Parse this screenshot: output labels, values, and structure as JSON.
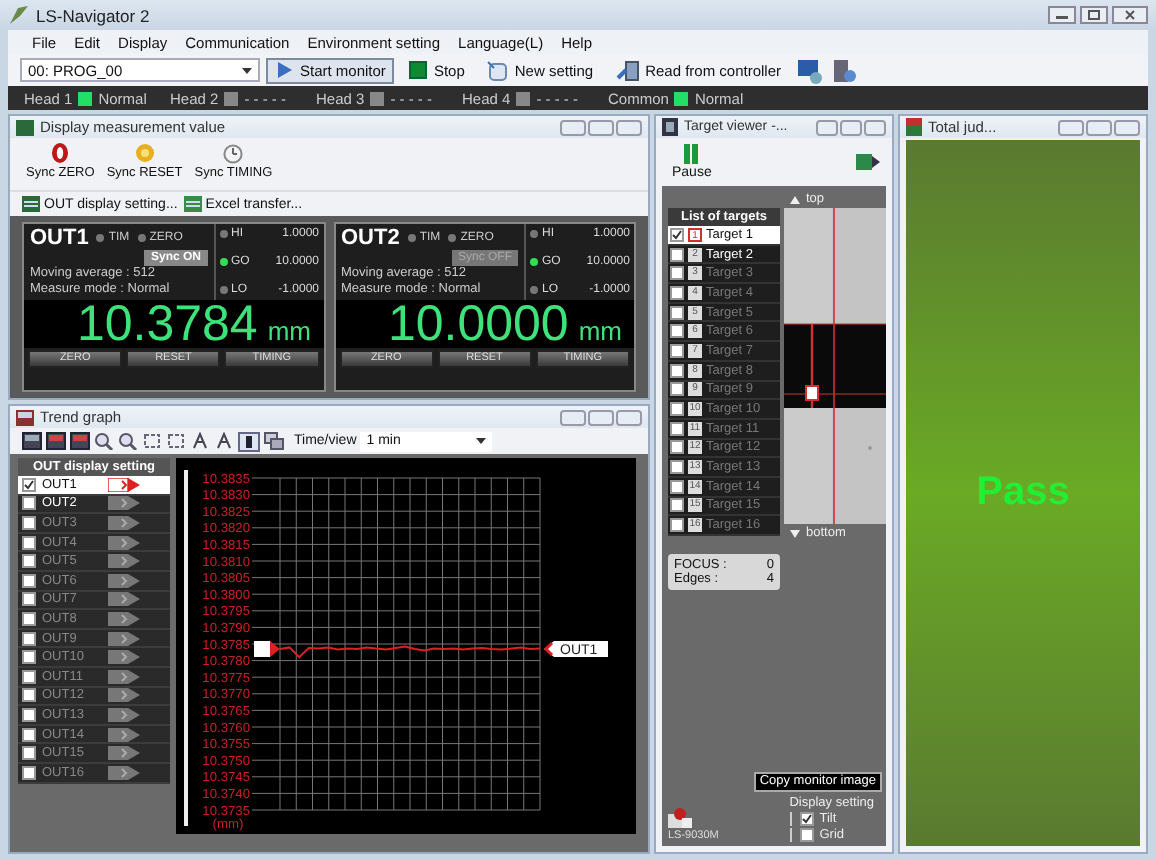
{
  "window": {
    "title": "LS-Navigator 2"
  },
  "menu": [
    "File",
    "Edit",
    "Display",
    "Communication",
    "Environment setting",
    "Language(L)",
    "Help"
  ],
  "toolbar": {
    "program": "00: PROG_00",
    "buttons": [
      {
        "kind": "start",
        "label": "Start monitor",
        "selected": true
      },
      {
        "kind": "stop",
        "label": "Stop",
        "selected": false
      },
      {
        "kind": "new",
        "label": "New setting",
        "selected": false
      },
      {
        "kind": "read",
        "label": "Read from controller",
        "selected": false
      }
    ]
  },
  "heads": [
    {
      "label": "Head 1",
      "status": "Normal",
      "color": "#22dd66"
    },
    {
      "label": "Head 2",
      "status": "- - - - -",
      "color": "#888888"
    },
    {
      "label": "Head 3",
      "status": "- - - - -",
      "color": "#888888"
    },
    {
      "label": "Head 4",
      "status": "- - - - -",
      "color": "#888888"
    },
    {
      "label": "Common",
      "status": "Normal",
      "color": "#22dd66"
    }
  ],
  "measurement": {
    "title": "Display measurement value",
    "sync_buttons": [
      {
        "kind": "zero",
        "label": "Sync ZERO"
      },
      {
        "kind": "reset",
        "label": "Sync RESET"
      },
      {
        "kind": "timing",
        "label": "Sync TIMING"
      }
    ],
    "links": [
      "OUT display setting...",
      "Excel transfer..."
    ],
    "outputs": [
      {
        "name": "OUT1",
        "indicators": [
          {
            "label": "TIM",
            "on": false
          },
          {
            "label": "ZERO",
            "on": false
          }
        ],
        "sync": {
          "label": "Sync ON",
          "on": true
        },
        "moving_average": "Moving average : 512",
        "measure_mode": "Measure mode : Normal",
        "limits": [
          {
            "label": "HI",
            "value": "1.0000",
            "on": false
          },
          {
            "label": "GO",
            "value": "10.0000",
            "on": true
          },
          {
            "label": "LO",
            "value": "-1.0000",
            "on": false
          }
        ],
        "value": "10.3784",
        "unit": "mm",
        "buttons": [
          "ZERO",
          "RESET",
          "TIMING"
        ]
      },
      {
        "name": "OUT2",
        "indicators": [
          {
            "label": "TIM",
            "on": false
          },
          {
            "label": "ZERO",
            "on": false
          }
        ],
        "sync": {
          "label": "Sync OFF",
          "on": false
        },
        "moving_average": "Moving average : 512",
        "measure_mode": "Measure mode : Normal",
        "limits": [
          {
            "label": "HI",
            "value": "1.0000",
            "on": false
          },
          {
            "label": "GO",
            "value": "10.0000",
            "on": true
          },
          {
            "label": "LO",
            "value": "-1.0000",
            "on": false
          }
        ],
        "value": "10.0000",
        "unit": "mm",
        "buttons": [
          "ZERO",
          "RESET",
          "TIMING"
        ]
      }
    ]
  },
  "trend": {
    "title": "Trend graph",
    "time_label": "Time/view",
    "time_value": "1 min",
    "out_header": "OUT display setting",
    "outs": [
      {
        "name": "OUT1",
        "checked": true,
        "enabled": true,
        "selected": true
      },
      {
        "name": "OUT2",
        "checked": false,
        "enabled": true,
        "selected": false
      },
      {
        "name": "OUT3",
        "checked": false,
        "enabled": false,
        "selected": false
      },
      {
        "name": "OUT4",
        "checked": false,
        "enabled": false,
        "selected": false
      },
      {
        "name": "OUT5",
        "checked": false,
        "enabled": false,
        "selected": false
      },
      {
        "name": "OUT6",
        "checked": false,
        "enabled": false,
        "selected": false
      },
      {
        "name": "OUT7",
        "checked": false,
        "enabled": false,
        "selected": false
      },
      {
        "name": "OUT8",
        "checked": false,
        "enabled": false,
        "selected": false
      },
      {
        "name": "OUT9",
        "checked": false,
        "enabled": false,
        "selected": false
      },
      {
        "name": "OUT10",
        "checked": false,
        "enabled": false,
        "selected": false
      },
      {
        "name": "OUT11",
        "checked": false,
        "enabled": false,
        "selected": false
      },
      {
        "name": "OUT12",
        "checked": false,
        "enabled": false,
        "selected": false
      },
      {
        "name": "OUT13",
        "checked": false,
        "enabled": false,
        "selected": false
      },
      {
        "name": "OUT14",
        "checked": false,
        "enabled": false,
        "selected": false
      },
      {
        "name": "OUT15",
        "checked": false,
        "enabled": false,
        "selected": false
      },
      {
        "name": "OUT16",
        "checked": false,
        "enabled": false,
        "selected": false
      }
    ],
    "chart_data": {
      "type": "line",
      "ylabel": "(mm)",
      "ylim": [
        10.3735,
        10.3835
      ],
      "grid": true,
      "yticks": [
        {
          "value": 10.3835,
          "label": "10.3835"
        },
        {
          "value": 10.383,
          "label": "10.3830"
        },
        {
          "value": 10.3825,
          "label": "10.3825"
        },
        {
          "value": 10.382,
          "label": "10.3820"
        },
        {
          "value": 10.3815,
          "label": "10.3815"
        },
        {
          "value": 10.381,
          "label": "10.3810"
        },
        {
          "value": 10.3805,
          "label": "10.3805"
        },
        {
          "value": 10.38,
          "label": "10.3800"
        },
        {
          "value": 10.3795,
          "label": "10.3795"
        },
        {
          "value": 10.379,
          "label": "10.3790"
        },
        {
          "value": 10.3785,
          "label": "10.3785"
        },
        {
          "value": 10.378,
          "label": "10.3780"
        },
        {
          "value": 10.3775,
          "label": "10.3775"
        },
        {
          "value": 10.377,
          "label": "10.3770"
        },
        {
          "value": 10.3765,
          "label": "10.3765"
        },
        {
          "value": 10.376,
          "label": "10.3760"
        },
        {
          "value": 10.3755,
          "label": "10.3755"
        },
        {
          "value": 10.375,
          "label": "10.3750"
        },
        {
          "value": 10.3745,
          "label": "10.3745"
        },
        {
          "value": 10.374,
          "label": "10.3740"
        },
        {
          "value": 10.3735,
          "label": "10.3735"
        }
      ],
      "series": [
        {
          "name": "OUT1",
          "color": "#e02020",
          "values": [
            10.37835,
            10.3784,
            10.3781,
            10.37838,
            10.37836,
            10.3784,
            10.37834,
            10.37837,
            10.37835,
            10.37839,
            10.37836,
            10.37834,
            10.37838,
            10.37842,
            10.37835,
            10.3783,
            10.37836,
            10.37835,
            10.37837,
            10.37834,
            10.37836,
            10.37838,
            10.37835,
            10.37833,
            10.37836,
            10.3784,
            10.37835,
            10.37837
          ]
        }
      ]
    }
  },
  "target": {
    "title": "Target viewer -...",
    "pause": "Pause",
    "list_header": "List of targets",
    "targets": [
      {
        "number": "1",
        "name": "Target 1",
        "checked": true,
        "enabled": true,
        "selected": true
      },
      {
        "number": "2",
        "name": "Target 2",
        "checked": false,
        "enabled": true,
        "selected": false
      },
      {
        "number": "3",
        "name": "Target 3",
        "checked": false,
        "enabled": false,
        "selected": false
      },
      {
        "number": "4",
        "name": "Target 4",
        "checked": false,
        "enabled": false,
        "selected": false
      },
      {
        "number": "5",
        "name": "Target 5",
        "checked": false,
        "enabled": false,
        "selected": false
      },
      {
        "number": "6",
        "name": "Target 6",
        "checked": false,
        "enabled": false,
        "selected": false
      },
      {
        "number": "7",
        "name": "Target 7",
        "checked": false,
        "enabled": false,
        "selected": false
      },
      {
        "number": "8",
        "name": "Target 8",
        "checked": false,
        "enabled": false,
        "selected": false
      },
      {
        "number": "9",
        "name": "Target 9",
        "checked": false,
        "enabled": false,
        "selected": false
      },
      {
        "number": "10",
        "name": "Target 10",
        "checked": false,
        "enabled": false,
        "selected": false
      },
      {
        "number": "11",
        "name": "Target 11",
        "checked": false,
        "enabled": false,
        "selected": false
      },
      {
        "number": "12",
        "name": "Target 12",
        "checked": false,
        "enabled": false,
        "selected": false
      },
      {
        "number": "13",
        "name": "Target 13",
        "checked": false,
        "enabled": false,
        "selected": false
      },
      {
        "number": "14",
        "name": "Target 14",
        "checked": false,
        "enabled": false,
        "selected": false
      },
      {
        "number": "15",
        "name": "Target 15",
        "checked": false,
        "enabled": false,
        "selected": false
      },
      {
        "number": "16",
        "name": "Target 16",
        "checked": false,
        "enabled": false,
        "selected": false
      }
    ],
    "top": "top",
    "bottom": "bottom",
    "focus_label": "FOCUS :",
    "focus": "0",
    "edges_label": "Edges :",
    "edges": "4",
    "copy": "Copy monitor image",
    "model": "LS-9030M",
    "display_setting": "Display setting",
    "options": [
      {
        "label": "Tilt",
        "checked": true
      },
      {
        "label": "Grid",
        "checked": false
      }
    ]
  },
  "total": {
    "title": "Total jud...",
    "result": "Pass"
  }
}
